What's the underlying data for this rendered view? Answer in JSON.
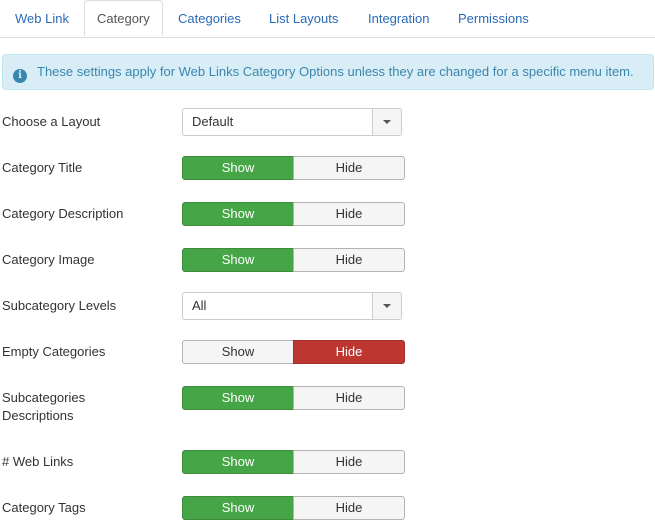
{
  "tabs": [
    {
      "label": "Web Link",
      "active": false
    },
    {
      "label": "Category",
      "active": true
    },
    {
      "label": "Categories",
      "active": false
    },
    {
      "label": "List Layouts",
      "active": false
    },
    {
      "label": "Integration",
      "active": false
    },
    {
      "label": "Permissions",
      "active": false
    }
  ],
  "alert": {
    "icon": "info-icon",
    "text": "These settings apply for Web Links Category Options unless they are changed for a specific menu item."
  },
  "fields": {
    "layout": {
      "label": "Choose a Layout",
      "value": "Default"
    },
    "category_title": {
      "label": "Category Title",
      "show": "Show",
      "hide": "Hide",
      "selected": "Show"
    },
    "category_description": {
      "label": "Category Description",
      "show": "Show",
      "hide": "Hide",
      "selected": "Show"
    },
    "category_image": {
      "label": "Category Image",
      "show": "Show",
      "hide": "Hide",
      "selected": "Show"
    },
    "subcategory_levels": {
      "label": "Subcategory Levels",
      "value": "All"
    },
    "empty_categories": {
      "label": "Empty Categories",
      "show": "Show",
      "hide": "Hide",
      "selected": "Hide"
    },
    "subcategories_descriptions": {
      "label": "Subcategories Descriptions",
      "show": "Show",
      "hide": "Hide",
      "selected": "Show"
    },
    "web_links": {
      "label": "# Web Links",
      "show": "Show",
      "hide": "Hide",
      "selected": "Show"
    },
    "category_tags": {
      "label": "Category Tags",
      "show": "Show",
      "hide": "Hide",
      "selected": "Show"
    }
  },
  "colors": {
    "show_active": "#46a546",
    "hide_active": "#bd362f",
    "link": "#2a69b8",
    "alert_bg": "#d9edf7"
  }
}
